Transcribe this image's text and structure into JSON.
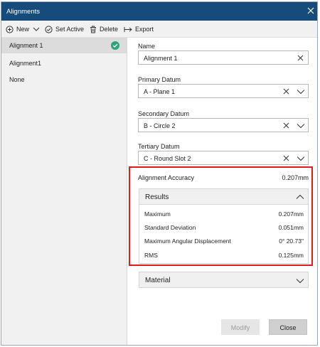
{
  "window": {
    "title": "Alignments"
  },
  "toolbar": {
    "new_label": "New",
    "set_active_label": "Set Active",
    "delete_label": "Delete",
    "export_label": "Export"
  },
  "alignments": [
    {
      "label": "Alignment 1",
      "selected": true,
      "active": true
    },
    {
      "label": "Alignment1",
      "selected": false,
      "active": false
    },
    {
      "label": "None",
      "selected": false,
      "active": false
    }
  ],
  "form": {
    "name_label": "Name",
    "name_value": "Alignment 1",
    "primary_label": "Primary Datum",
    "primary_value": "A - Plane 1",
    "secondary_label": "Secondary Datum",
    "secondary_value": "B - Circle 2",
    "tertiary_label": "Tertiary Datum",
    "tertiary_value": "C - Round Slot 2"
  },
  "accuracy": {
    "label": "Alignment Accuracy",
    "value": "0.207mm"
  },
  "results": {
    "title": "Results",
    "rows": [
      {
        "label": "Maximum",
        "value": "0.207mm"
      },
      {
        "label": "Standard Deviation",
        "value": "0.051mm"
      },
      {
        "label": "Maximum Angular Displacement",
        "value": "0° 20.73\""
      },
      {
        "label": "RMS",
        "value": "0.125mm"
      }
    ]
  },
  "material": {
    "title": "Material"
  },
  "buttons": {
    "modify_label": "Modify",
    "close_label": "Close"
  },
  "colors": {
    "titlebar": "#154c7b",
    "check": "#2aa37f",
    "highlight": "#e31a1a"
  }
}
